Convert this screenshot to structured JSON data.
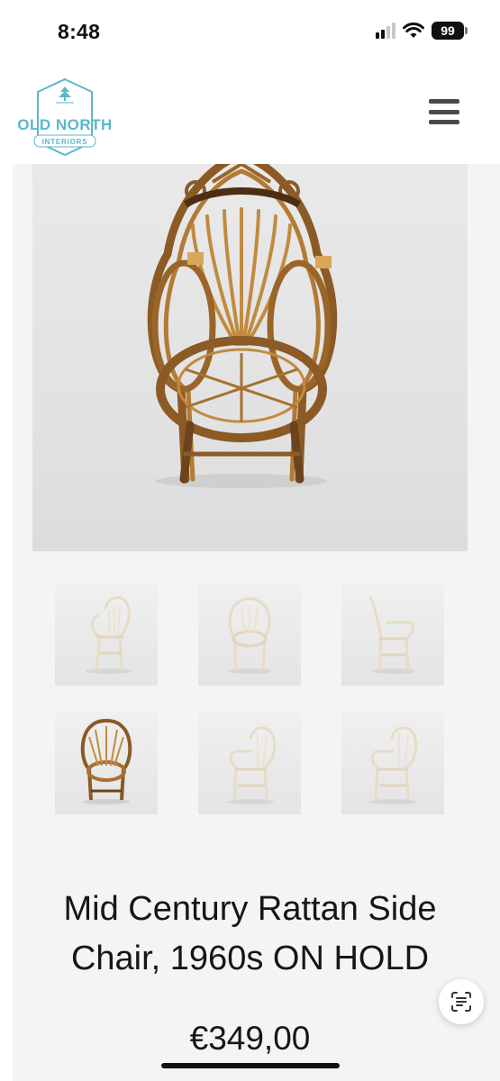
{
  "status_bar": {
    "time": "8:48",
    "battery": "99",
    "icons": [
      "signal-icon",
      "wifi-icon",
      "battery-icon"
    ]
  },
  "header": {
    "logo": {
      "line1": "OLD NORTH",
      "line2": "INTERIORS",
      "color": "#5bb8c9"
    },
    "menu_icon": "hamburger-menu-icon"
  },
  "product": {
    "main_image": "rattan-chair-front-photo",
    "thumbnails": [
      {
        "name": "chair-side-view-white"
      },
      {
        "name": "chair-front-view-white"
      },
      {
        "name": "chair-profile-view-white"
      },
      {
        "name": "chair-front-view-natural"
      },
      {
        "name": "chair-angle-view-white"
      },
      {
        "name": "chair-angle-view-white-2"
      }
    ],
    "title_line1": "Mid Century Rattan Side",
    "title_line2": "Chair, 1960s ON HOLD",
    "price": "€349,00"
  },
  "colors": {
    "rattan": "#a8702c",
    "rattan_dark": "#6b4320",
    "page_bg": "#f4f4f4",
    "accent": "#5bb8c9"
  },
  "floating": {
    "icon": "text-scan-icon"
  }
}
